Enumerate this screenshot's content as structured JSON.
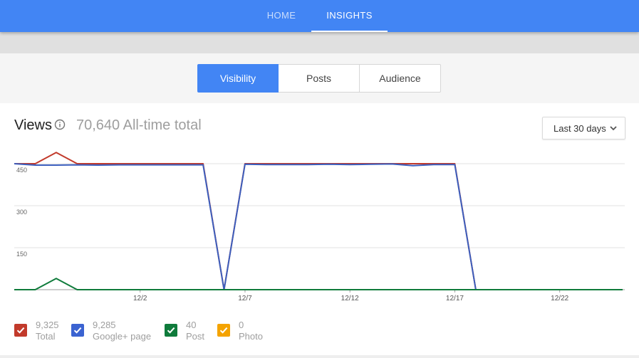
{
  "nav": {
    "tabs": [
      {
        "label": "HOME",
        "active": false
      },
      {
        "label": "INSIGHTS",
        "active": true
      }
    ]
  },
  "segments": {
    "buttons": [
      {
        "label": "Visibility",
        "active": true
      },
      {
        "label": "Posts",
        "active": false
      },
      {
        "label": "Audience",
        "active": false
      }
    ]
  },
  "views": {
    "title": "Views",
    "info_icon": "info-circle-icon",
    "total": "70,640 All-time total"
  },
  "range_dropdown": {
    "label": "Last 30 days",
    "icon": "chevron-down-icon"
  },
  "chart_data": {
    "type": "line",
    "x": [
      "11/26",
      "11/27",
      "11/28",
      "11/29",
      "11/30",
      "12/1",
      "12/2",
      "12/3",
      "12/4",
      "12/5",
      "12/6",
      "12/7",
      "12/8",
      "12/9",
      "12/10",
      "12/11",
      "12/12",
      "12/13",
      "12/14",
      "12/15",
      "12/16",
      "12/17",
      "12/18",
      "12/19",
      "12/20",
      "12/21",
      "12/22",
      "12/23",
      "12/24",
      "12/25"
    ],
    "x_tick_labels": [
      "12/2",
      "12/7",
      "12/12",
      "12/17",
      "12/22"
    ],
    "y_ticks": [
      150,
      300,
      450
    ],
    "ylim": [
      0,
      510
    ],
    "grid": true,
    "series": [
      {
        "name": "Total",
        "color": "#c23a2b",
        "values": [
          450,
          450,
          490,
          450,
          450,
          450,
          450,
          450,
          450,
          450,
          0,
          450,
          450,
          450,
          450,
          450,
          450,
          450,
          450,
          450,
          450,
          450,
          0,
          0,
          0,
          0,
          0,
          0,
          0,
          0
        ]
      },
      {
        "name": "Google+ page",
        "color": "#3c5fbe",
        "values": [
          450,
          445,
          445,
          446,
          445,
          446,
          446,
          446,
          446,
          446,
          0,
          448,
          447,
          447,
          447,
          448,
          447,
          448,
          449,
          443,
          447,
          447,
          0,
          0,
          0,
          0,
          0,
          0,
          0,
          0
        ]
      },
      {
        "name": "Post",
        "color": "#0f7b3b",
        "values": [
          0,
          0,
          40,
          0,
          0,
          0,
          0,
          0,
          0,
          0,
          0,
          0,
          0,
          0,
          0,
          0,
          0,
          0,
          0,
          0,
          0,
          0,
          0,
          0,
          0,
          0,
          0,
          0,
          0,
          0
        ]
      }
    ]
  },
  "legend": [
    {
      "value": "9,325",
      "label": "Total",
      "color": "#c23a2b",
      "checked": true
    },
    {
      "value": "9,285",
      "label": "Google+ page",
      "color": "#3b63d1",
      "checked": true
    },
    {
      "value": "40",
      "label": "Post",
      "color": "#0f7b3b",
      "checked": true
    },
    {
      "value": "0",
      "label": "Photo",
      "color": "#f4a300",
      "checked": true
    }
  ]
}
